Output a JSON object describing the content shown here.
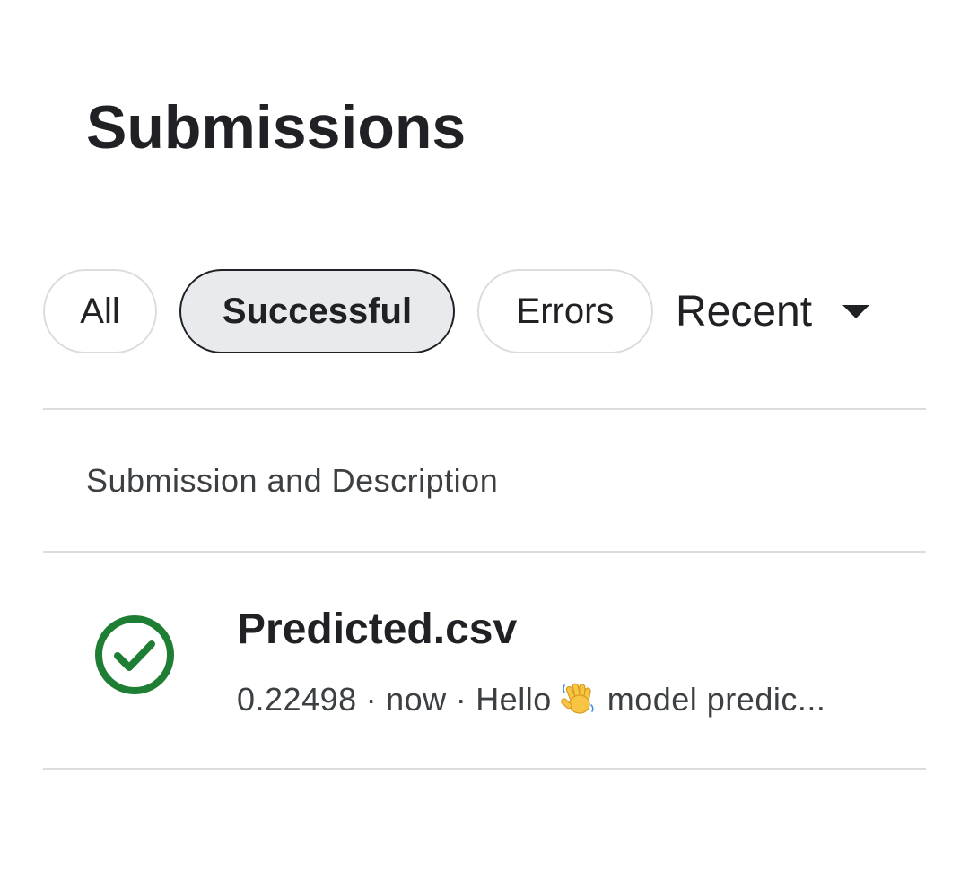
{
  "page": {
    "title": "Submissions"
  },
  "filters": {
    "all_label": "All",
    "successful_label": "Successful",
    "errors_label": "Errors",
    "selected": "Successful"
  },
  "sort": {
    "label": "Recent",
    "icon": "caret-down-icon"
  },
  "table": {
    "header": "Submission and Description",
    "rows": [
      {
        "status": "success",
        "status_icon": "check-circle-icon",
        "status_color": "#1e7e34",
        "file_name": "Predicted.csv",
        "score": "0.22498",
        "time": "now",
        "separator": "·",
        "description_prefix": "Hello",
        "description_emoji": "waving-hand-icon",
        "description_suffix": "model predic..."
      }
    ]
  }
}
